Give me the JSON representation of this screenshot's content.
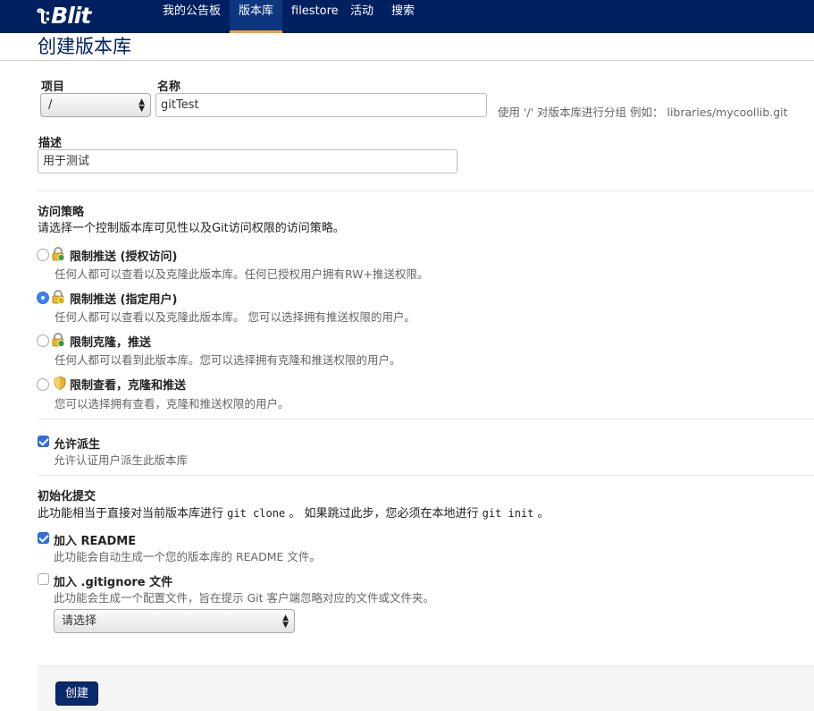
{
  "brand": {
    "name": "Blit"
  },
  "nav": {
    "items": [
      {
        "label": "我的公告板"
      },
      {
        "label": "版本库"
      },
      {
        "label": "filestore"
      },
      {
        "label": "活动"
      },
      {
        "label": "搜索"
      }
    ],
    "active_index": 1
  },
  "page": {
    "title": "创建版本库"
  },
  "form": {
    "project": {
      "label": "项目",
      "value": "/"
    },
    "name": {
      "label": "名称",
      "value": "gitTest",
      "help": "使用 '/' 对版本库进行分组 例如： libraries/mycoollib.git"
    },
    "description": {
      "label": "描述",
      "value": "用于测试"
    },
    "access_policy": {
      "title": "访问策略",
      "subtitle": "请选择一个控制版本库可见性以及Git访问权限的访问策略。",
      "selected_index": 1,
      "options": [
        {
          "label": "限制推送 (授权访问)",
          "desc": "任何人都可以查看以及克隆此版本库。任何已授权用户拥有RW+推送权限。",
          "icon": "lock-green-icon"
        },
        {
          "label": "限制推送 (指定用户)",
          "desc": "任何人都可以查看以及克隆此版本库。 您可以选择拥有推送权限的用户。",
          "icon": "lock-yellow-icon"
        },
        {
          "label": "限制克隆，推送",
          "desc": "任何人都可以看到此版本库。您可以选择拥有克隆和推送权限的用户。",
          "icon": "lock-orange-icon"
        },
        {
          "label": "限制查看，克隆和推送",
          "desc": "您可以选择拥有查看，克隆和推送权限的用户。",
          "icon": "shield-icon"
        }
      ]
    },
    "allow_forks": {
      "label": "允许派生",
      "desc": "允许认证用户派生此版本库",
      "checked": true
    },
    "init": {
      "title": "初始化提交",
      "desc_part1": "此功能相当于直接对当前版本库进行",
      "code1": "git clone",
      "desc_part2": "。 如果跳过此步，您必须在本地进行",
      "code2": "git init",
      "desc_part3": "。"
    },
    "add_readme": {
      "label": "加入 README",
      "desc": "此功能会自动生成一个您的版本库的 README 文件。",
      "checked": true
    },
    "add_gitignore": {
      "label": "加入 .gitignore 文件",
      "desc": "此功能会生成一个配置文件，旨在提示 Git 客户端忽略对应的文件或文件夹。",
      "checked": false,
      "select_value": "请选择"
    },
    "submit_label": "创建"
  },
  "colors": {
    "navbar": "#002060",
    "accent": "#f0a030",
    "primary_button": "#0b2a6b",
    "checkbox": "#2f6fe0"
  }
}
